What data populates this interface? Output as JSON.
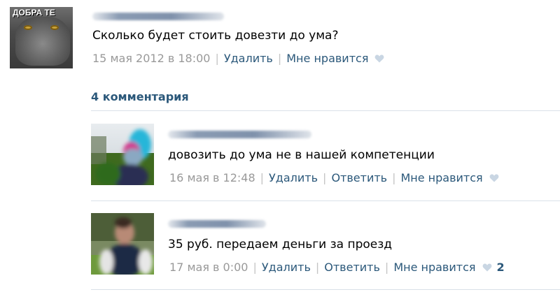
{
  "post": {
    "avatar_caption": "ДОБРА ТЕ",
    "text": "Сколько будет стоить довезти до ума?",
    "date": "15 мая 2012 в 18:00",
    "delete_label": "Удалить",
    "like_label": "Мне нравится",
    "like_icon": "heart-icon"
  },
  "comments_header": "4 комментария",
  "comments": [
    {
      "text": "довозить до ума не в нашей компетенции",
      "date": "16 мая в 12:48",
      "delete_label": "Удалить",
      "reply_label": "Ответить",
      "like_label": "Мне нравится",
      "like_icon": "heart-icon",
      "like_count": ""
    },
    {
      "text": "35 руб. передаем деньги за проезд",
      "date": "17 мая в 0:00",
      "delete_label": "Удалить",
      "reply_label": "Ответить",
      "like_label": "Мне нравится",
      "like_icon": "heart-icon",
      "like_count": "2"
    }
  ],
  "colors": {
    "link": "#2b587a",
    "date": "#999999",
    "separator": "#c4c4c4",
    "heart": "#c9d6e3",
    "divider": "#dae1e8"
  }
}
